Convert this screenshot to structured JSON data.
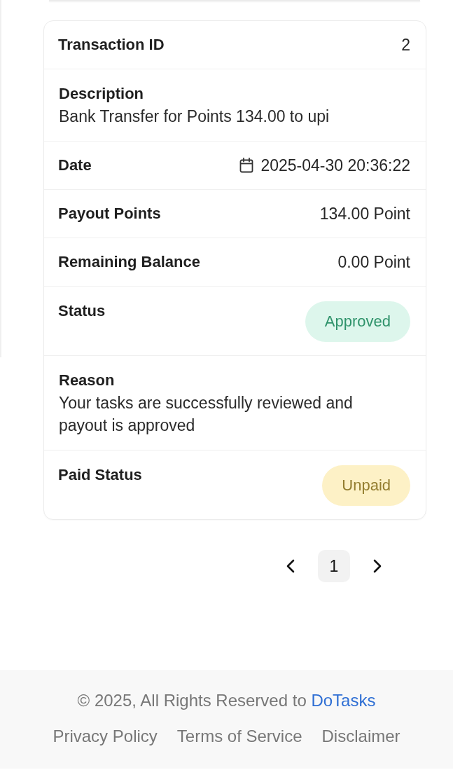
{
  "transaction_card": {
    "rows": [
      {
        "kind": "inline",
        "label": "Transaction ID",
        "value": "2"
      },
      {
        "kind": "stacked",
        "label": "Description",
        "value": "Bank Transfer for Points 134.00 to upi"
      },
      {
        "kind": "date",
        "label": "Date",
        "value": "2025-04-30 20:36:22"
      },
      {
        "kind": "inline",
        "label": "Payout Points",
        "value": "134.00 Point"
      },
      {
        "kind": "inline",
        "label": "Remaining Balance",
        "value": "0.00 Point"
      },
      {
        "kind": "badge",
        "label": "Status",
        "value": "Approved",
        "color": "#ddf6ec"
      },
      {
        "kind": "stacked",
        "label": "Reason",
        "value": "Your tasks are successfully reviewed and payout is approved"
      },
      {
        "kind": "badge",
        "label": "Paid Status",
        "value": "Unpaid",
        "color": "#fdf1c6"
      }
    ]
  },
  "pagination": {
    "pages": [
      {
        "label": "1",
        "selected": true
      }
    ]
  },
  "footer": {
    "copyright": "© 2025, All Rights Reserved to",
    "brand_link": "DoTasks",
    "links": [
      "Privacy Policy",
      "Terms of Service",
      "Disclaimer"
    ]
  }
}
